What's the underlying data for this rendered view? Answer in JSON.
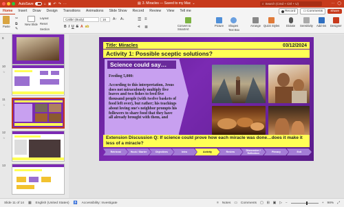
{
  "titlebar": {
    "autosave_label": "AutoSave",
    "doc_title": "3. Miracles — Saved to my Mac",
    "search_placeholder": "Search (Cmd + Ctrl + U)"
  },
  "tabs": [
    "Home",
    "Insert",
    "Draw",
    "Design",
    "Transitions",
    "Animations",
    "Slide Show",
    "Record",
    "Review",
    "View",
    "Tell me"
  ],
  "ribbon_actions": {
    "record": "Record",
    "comments": "Comments",
    "share": "Share"
  },
  "ribbon": {
    "paste": "Paste",
    "new_slide": "New Slide",
    "layout": "Layout",
    "reset": "Reset",
    "section": "Section",
    "font_name": "Calibri (Body)",
    "font_size": "16",
    "convert_smartart": "Convert to SmartArt",
    "picture": "Picture",
    "text_box": "Text Box",
    "shapes": "Shapes",
    "arrange": "Arrange",
    "quick_styles": "Quick Styles",
    "dictate": "Dictate",
    "sensitivity": "Sensitivity",
    "add_ins": "Add-ins",
    "designer": "Designer"
  },
  "thumbnails": [
    {
      "number": "9",
      "kind": "photo"
    },
    {
      "number": "10",
      "kind": "diagram"
    },
    {
      "number": "11",
      "kind": "text-grid"
    },
    {
      "number": "12",
      "kind": "video"
    },
    {
      "number": "13",
      "kind": "boxes"
    }
  ],
  "slide": {
    "title": "Title:  Miracles",
    "date": "03/12/2024",
    "activity": "Activity 1: Possible sceptic solutions?",
    "panel_heading": "Science could say…",
    "panel_subheading": "Feeding 5,000:",
    "panel_body": "According to this interpretation, Jesus does not miraculously multiply five loaves and two fishes to feed five thousand people (with twelve baskets of food left over), but rather; his teachings about loving one's neighbor prompts his followers to share food that they have all already brought with them, and",
    "extension": "Extension Discussion Q: If science could prove how each miracle was done…does it make it less of a miracle?",
    "nav": [
      "Retrieval",
      "Hook / Starter",
      "Objectives",
      "Intro",
      "Activity",
      "Review",
      "Discussion / Reflection",
      "Plenary",
      "Exit"
    ],
    "active_nav_index": 4
  },
  "status": {
    "slide_info": "Slide 11 of 14",
    "language": "English (United States)",
    "accessibility": "Accessibility: Investigate",
    "notes": "Notes",
    "comments": "Comments",
    "zoom": "98%"
  },
  "colors": {
    "accent": "#c73a1c",
    "slide_purple": "#6a2a9c",
    "highlight_yellow": "#ffff55",
    "panel_lilac": "#c8a0f0"
  }
}
